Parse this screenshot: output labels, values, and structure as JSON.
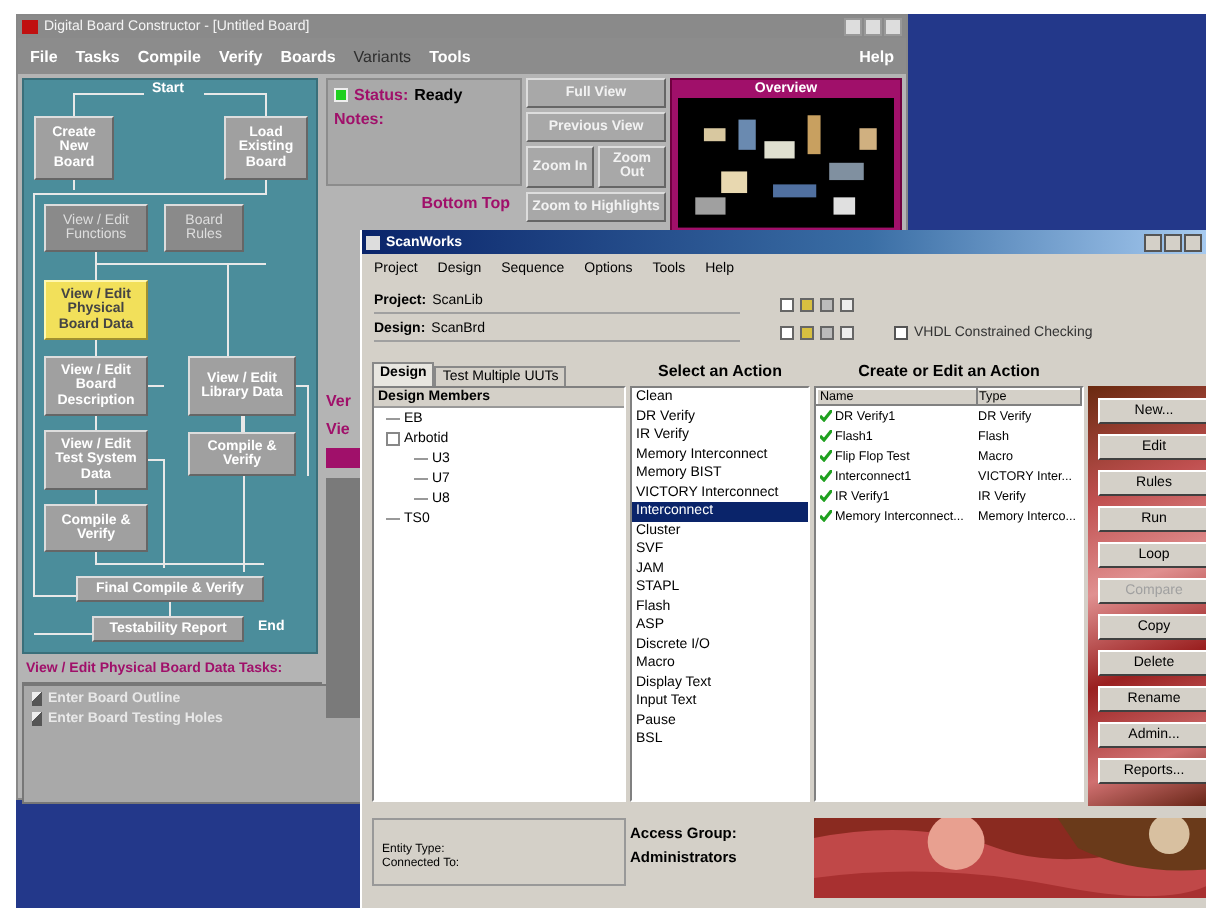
{
  "main_window": {
    "title": "Digital Board Constructor - [Untitled Board]",
    "menu": [
      {
        "label": "File",
        "disabled": false
      },
      {
        "label": "Tasks",
        "disabled": false
      },
      {
        "label": "Compile",
        "disabled": false
      },
      {
        "label": "Verify",
        "disabled": false
      },
      {
        "label": "Boards",
        "disabled": false
      },
      {
        "label": "Variants",
        "disabled": true
      },
      {
        "label": "Tools",
        "disabled": false
      },
      {
        "label": "Help",
        "disabled": false
      }
    ],
    "flow": {
      "start": "Start",
      "end": "End",
      "steps": [
        {
          "text": "Create New Board",
          "kind": "normal",
          "selected": false
        },
        {
          "text": "Load Existing Board",
          "kind": "normal",
          "selected": false
        },
        {
          "text": "View / Edit Functions",
          "kind": "disabled",
          "selected": false
        },
        {
          "text": "Board Rules",
          "kind": "disabled",
          "selected": false
        },
        {
          "text": "View / Edit Physical Board Data",
          "kind": "normal",
          "selected": true
        },
        {
          "text": "View / Edit Board Description",
          "kind": "normal",
          "selected": false
        },
        {
          "text": "View / Edit Library Data",
          "kind": "normal",
          "selected": false
        },
        {
          "text": "View / Edit Test System Data",
          "kind": "normal",
          "selected": false
        },
        {
          "text": "Compile & Verify",
          "kind": "normal",
          "selected": false
        },
        {
          "text": "Compile & Verify",
          "kind": "normal",
          "selected": false
        },
        {
          "text": "Final Compile & Verify",
          "kind": "normal",
          "selected": false
        },
        {
          "text": "Testability Report",
          "kind": "normal",
          "selected": false
        }
      ]
    },
    "status": {
      "label": "Status:",
      "value": "Ready",
      "notes_label": "Notes:"
    },
    "view_buttons": [
      "Full View",
      "Previous View",
      "Zoom In",
      "Zoom Out",
      "Zoom to Highlights"
    ],
    "side": "Bottom Top",
    "overview": {
      "title": "Overview"
    },
    "cut_labels": [
      "Ver",
      "Vie"
    ],
    "tasks": {
      "title": "View / Edit Physical Board Data Tasks:",
      "items": [
        "Enter Board Outline",
        "Enter Board Testing Holes"
      ]
    }
  },
  "scanworks": {
    "title": "ScanWorks",
    "menu": [
      "Project",
      "Design",
      "Sequence",
      "Options",
      "Tools",
      "Help"
    ],
    "project": {
      "label": "Project:",
      "value": "ScanLib"
    },
    "design": {
      "label": "Design:",
      "value": "ScanBrd"
    },
    "vhdl": {
      "label": "VHDL Constrained Checking",
      "checked": false
    },
    "tabs": [
      {
        "label": "Design",
        "selected": true
      },
      {
        "label": "Test Multiple UUTs",
        "selected": false
      }
    ],
    "tree": {
      "title": "Design Members",
      "items": [
        {
          "label": "EB",
          "expanded": false
        },
        {
          "label": "Arbotid",
          "expanded": true,
          "children": [
            {
              "label": "U3",
              "expanded": false
            },
            {
              "label": "U7",
              "expanded": false
            },
            {
              "label": "U8",
              "expanded": false
            }
          ]
        },
        {
          "label": "TS0",
          "expanded": false
        }
      ]
    },
    "entity": [
      "Entity Type:",
      "Connected To:"
    ],
    "actions": {
      "title": "Select an Action",
      "items": [
        {
          "label": "Clean",
          "selected": false
        },
        {
          "label": "DR Verify",
          "selected": false
        },
        {
          "label": "IR Verify",
          "selected": false
        },
        {
          "label": "Memory Interconnect",
          "selected": false
        },
        {
          "label": "Memory BIST",
          "selected": false
        },
        {
          "label": "VICTORY Interconnect",
          "selected": false
        },
        {
          "label": "Interconnect",
          "selected": true
        },
        {
          "label": "Cluster",
          "selected": false
        },
        {
          "label": "SVF",
          "selected": false
        },
        {
          "label": "JAM",
          "selected": false
        },
        {
          "label": "STAPL",
          "selected": false
        },
        {
          "label": "Flash",
          "selected": false
        },
        {
          "label": "ASP",
          "selected": false
        },
        {
          "label": "Discrete I/O",
          "selected": false
        },
        {
          "label": "Macro",
          "selected": false
        },
        {
          "label": "Display Text",
          "selected": false
        },
        {
          "label": "Input Text",
          "selected": false
        },
        {
          "label": "Pause",
          "selected": false
        },
        {
          "label": "BSL",
          "selected": false
        }
      ]
    },
    "access": {
      "label": "Access Group:",
      "value": "Administrators"
    },
    "create": {
      "title": "Create or Edit an Action",
      "columns": [
        "Name",
        "Type"
      ],
      "rows": [
        [
          "DR Verify1",
          "DR Verify"
        ],
        [
          "Flash1",
          "Flash"
        ],
        [
          "Flip Flop Test",
          "Macro"
        ],
        [
          "Interconnect1",
          "VICTORY Inter..."
        ],
        [
          "IR Verify1",
          "IR Verify"
        ],
        [
          "Memory Interconnect...",
          "Memory Interco..."
        ]
      ]
    },
    "buttons": [
      {
        "label": "New...",
        "disabled": false
      },
      {
        "label": "Edit",
        "disabled": false
      },
      {
        "label": "Rules",
        "disabled": false
      },
      {
        "label": "Run",
        "disabled": false
      },
      {
        "label": "Loop",
        "disabled": false
      },
      {
        "label": "Compare",
        "disabled": true
      },
      {
        "label": "Copy",
        "disabled": false
      },
      {
        "label": "Delete",
        "disabled": false
      },
      {
        "label": "Rename",
        "disabled": false
      },
      {
        "label": "Admin...",
        "disabled": false
      },
      {
        "label": "Reports...",
        "disabled": false
      }
    ]
  }
}
